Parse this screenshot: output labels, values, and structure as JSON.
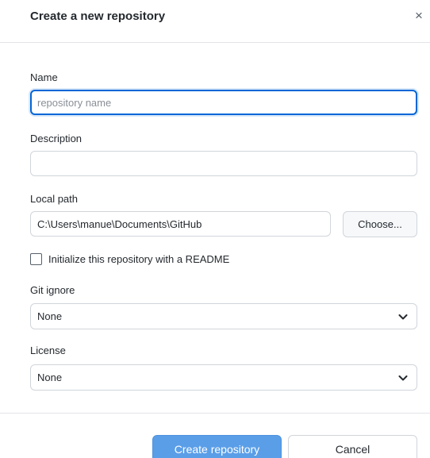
{
  "dialog": {
    "title": "Create a new repository",
    "close_glyph": "×"
  },
  "name": {
    "label": "Name",
    "value": "",
    "placeholder": "repository name"
  },
  "description": {
    "label": "Description",
    "value": "",
    "placeholder": ""
  },
  "local_path": {
    "label": "Local path",
    "value": "C:\\Users\\manue\\Documents\\GitHub",
    "choose_label": "Choose..."
  },
  "readme": {
    "label": "Initialize this repository with a README",
    "checked": false
  },
  "gitignore": {
    "label": "Git ignore",
    "selected": "None"
  },
  "license": {
    "label": "License",
    "selected": "None"
  },
  "footer": {
    "create_label": "Create repository",
    "cancel_label": "Cancel"
  },
  "colors": {
    "accent": "#0366d6",
    "primary_button": "#5a9ee8",
    "border": "#d1d5da"
  },
  "icons": {
    "close": "close-icon",
    "select_chevron": "chevron-down-icon"
  }
}
